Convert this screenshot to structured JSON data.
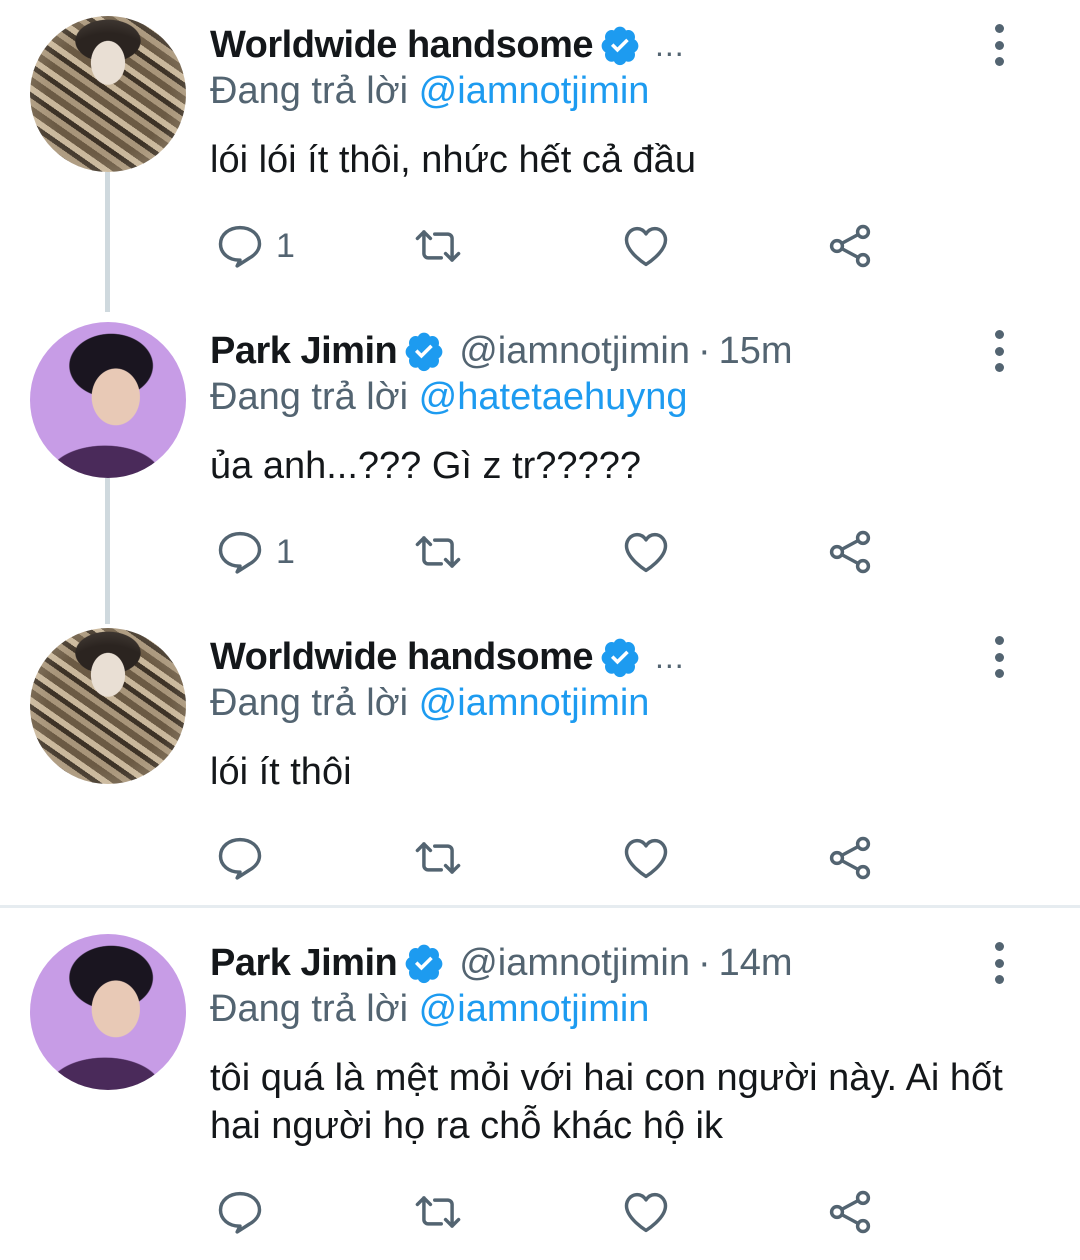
{
  "colors": {
    "link": "#1d9bf0",
    "secondary_text": "#536471",
    "primary_text": "#14171a",
    "verified": "#1d9bf0"
  },
  "tweets": [
    {
      "author": "Worldwide handsome",
      "avatar": "fur-coat-avatar",
      "verified": true,
      "handle": "",
      "time": "",
      "ellipsis": "...",
      "reply_prefix": "Đang trả lời",
      "reply_to": "@iamnotjimin",
      "body": "lói lói ít thôi, nhức hết cả đầu",
      "reply_count": "1"
    },
    {
      "author": "Park Jimin",
      "avatar": "purple-background-avatar",
      "verified": true,
      "handle": "@iamnotjimin",
      "separator": "·",
      "time": "15m",
      "reply_prefix": "Đang trả lời",
      "reply_to": "@hatetaehuyng",
      "body": "ủa anh...??? Gì z tr?????",
      "reply_count": "1"
    },
    {
      "author": "Worldwide handsome",
      "avatar": "fur-coat-avatar",
      "verified": true,
      "handle": "",
      "time": "",
      "ellipsis": "...",
      "reply_prefix": "Đang trả lời",
      "reply_to": "@iamnotjimin",
      "body": "lói ít thôi",
      "reply_count": ""
    },
    {
      "author": "Park Jimin",
      "avatar": "purple-background-avatar",
      "verified": true,
      "handle": "@iamnotjimin",
      "separator": "·",
      "time": "14m",
      "reply_prefix": "Đang trả lời",
      "reply_to": "@iamnotjimin",
      "body": "tôi quá là mệt mỏi với hai con người này. Ai hốt hai người họ ra chỗ khác hộ ik",
      "reply_count": ""
    }
  ],
  "icons": [
    "reply-icon",
    "retweet-icon",
    "like-icon",
    "share-icon",
    "more-options-icon",
    "verified-badge-icon"
  ]
}
